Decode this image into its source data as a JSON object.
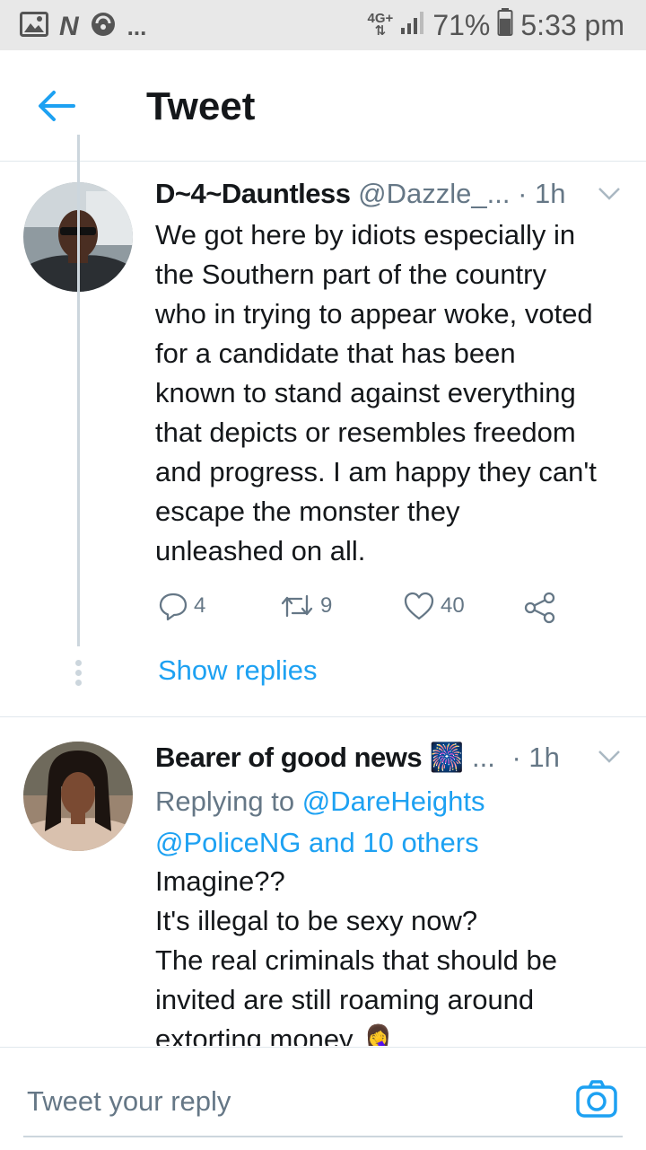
{
  "status_bar": {
    "icons_left": [
      "image-icon",
      "n-logo-icon",
      "circle-app-icon"
    ],
    "n_glyph": "N",
    "overflow": "...",
    "network_top": "4G+",
    "network_arrows": "⇅",
    "battery_percent": "71%",
    "battery_level": 0.71,
    "time": "5:33 pm"
  },
  "header": {
    "back_icon": "back-arrow-icon",
    "title": "Tweet"
  },
  "tweets": [
    {
      "display_name": "D~4~Dauntless",
      "handle": "@Dazzle_...",
      "separator": "·",
      "time": "1h",
      "body_lines": [
        "We got here by idiots especially in",
        "the Southern part of the country",
        "who in trying to appear woke, voted",
        "for a candidate that has been",
        "known to stand against everything",
        "that depicts or resembles freedom",
        "and progress. I am happy they can't",
        "escape the monster they",
        "unleashed on all."
      ],
      "actions": {
        "replies": "4",
        "retweets": "9",
        "likes": "40"
      },
      "show_replies": "Show replies"
    },
    {
      "display_name": "Bearer of good news",
      "emoji": "🎆",
      "truncation": "...",
      "separator": "·",
      "time": "1h",
      "replying_prefix": "Replying to",
      "replying_handle": "@DareHeights",
      "replying_line2": "@PoliceNG and 10 others",
      "body_lines": [
        "Imagine??",
        "It's illegal to be sexy now?",
        "The real criminals that should be",
        "invited are still roaming around",
        "extorting money 🤦‍♀️"
      ]
    }
  ],
  "reply_bar": {
    "placeholder": "Tweet your reply",
    "camera_icon": "camera-icon"
  },
  "colors": {
    "accent": "#1da1f2",
    "secondary_text": "#657786",
    "divider": "#e1e8ed",
    "status_bar_bg": "#e8e8e8"
  }
}
